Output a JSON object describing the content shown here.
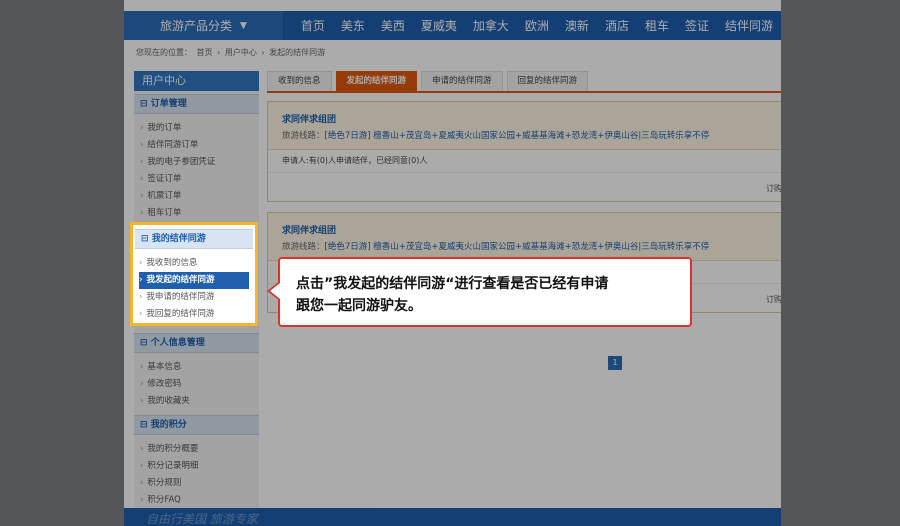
{
  "header": {
    "category_label": "旅游产品分类",
    "nav": [
      "首页",
      "美东",
      "美西",
      "夏威夷",
      "加拿大",
      "欧洲",
      "澳新",
      "酒店",
      "租车",
      "签证",
      "结伴同游"
    ]
  },
  "breadcrumb": [
    "您现在的位置：",
    "首页",
    "›",
    "用户中心",
    "›",
    "发起的结伴同游"
  ],
  "sidebar": {
    "title": "用户中心",
    "sections": [
      {
        "title": "订单管理",
        "items": [
          "我的订单",
          "结伴同游订单",
          "我的电子参团凭证",
          "签证订单",
          "机票订单",
          "租车订单"
        ]
      },
      {
        "title": "我的结伴同游",
        "items": [
          "我收到的信息",
          "我发起的结伴同游",
          "我申请的结伴同游",
          "我回复的结伴同游"
        ]
      },
      {
        "title": "个人信息管理",
        "items": [
          "基本信息",
          "修改密码",
          "我的收藏夹"
        ]
      },
      {
        "title": "我的积分",
        "items": [
          "我的积分概要",
          "积分记录明细",
          "积分规则",
          "积分FAQ"
        ]
      }
    ]
  },
  "tabs": [
    "收到的信息",
    "发起的结伴同游",
    "申请的结伴同游",
    "回复的结伴同游"
  ],
  "cards": [
    {
      "title": "求同伴求组团",
      "route_label": "旅游线路：",
      "route": "[绝色7日游] 檀香山+茂宜岛+夏威夷火山国家公园+威基基海滩+恐龙湾+伊奥山谷|三岛玩转乐享不停",
      "request": "申请人:有(0)人申请结伴，已经同意(0)人",
      "order": "订购"
    },
    {
      "title": "求同伴求组团",
      "route_label": "旅游线路：",
      "route": "[绝色7日游] 檀香山+茂宜岛+夏威夷火山国家公园+威基基海滩+恐龙湾+伊奥山谷|三岛玩转乐享不停",
      "order": "订购"
    }
  ],
  "pager": {
    "current": "1"
  },
  "footer": {
    "slogan": "自由行美国 旅游专家"
  },
  "callout": {
    "line1": "点击”我发起的结伴同游“进行查看是否已经有申请",
    "line2": "跟您一起同游驴友。"
  }
}
